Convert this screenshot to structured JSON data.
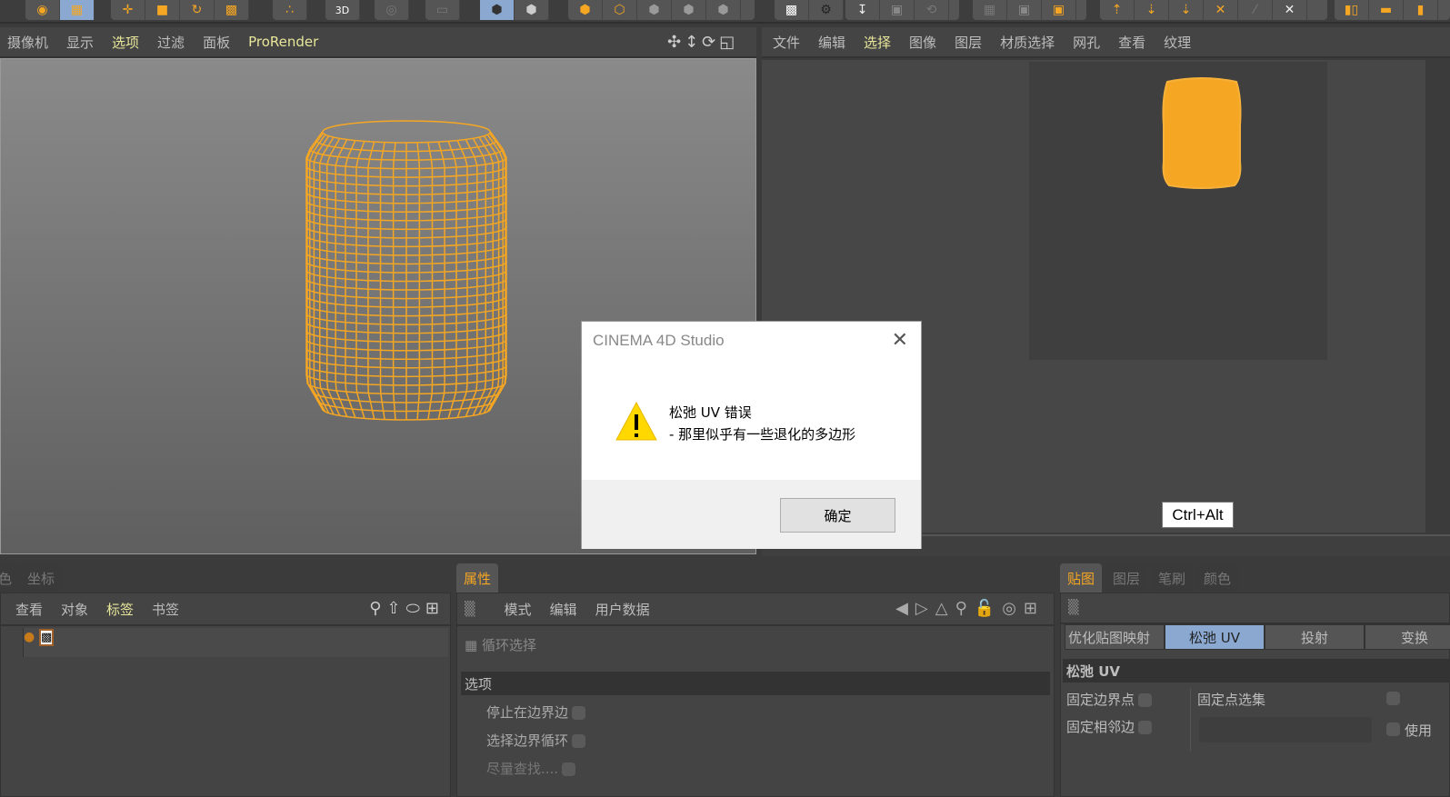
{
  "colors": {
    "accent": "#f5a623",
    "highlight": "#e7e69a",
    "selected": "#8aa8d0"
  },
  "viewport_menu": [
    "摄像机",
    "显示",
    "选项",
    "过滤",
    "面板",
    "ProRender"
  ],
  "viewport_menu_highlight": [
    2,
    5
  ],
  "uv_menu": [
    "文件",
    "编辑",
    "选择",
    "图像",
    "图层",
    "材质选择",
    "网孔",
    "查看",
    "纹理"
  ],
  "uv_menu_highlight": [
    2
  ],
  "objects_panel": {
    "tabs": [
      "色",
      "坐标"
    ],
    "menu": [
      "查看",
      "对象",
      "标签",
      "书签"
    ],
    "highlight": 2
  },
  "attributes_panel": {
    "tab": "属性",
    "menu": [
      "模式",
      "编辑",
      "用户数据"
    ],
    "tool_name": "循环选择",
    "section": "选项",
    "options": [
      {
        "label": "停止在边界边",
        "checked": false
      },
      {
        "label": "选择边界循环",
        "checked": false
      },
      {
        "label": "尽量查找....",
        "checked": false
      }
    ]
  },
  "uv_panel": {
    "tabs": [
      "贴图",
      "图层",
      "笔刷",
      "颜色"
    ],
    "subtabs": [
      "优化贴图映射",
      "松弛 UV",
      "投射",
      "变换"
    ],
    "active_subtab": 1,
    "section": "松弛 UV",
    "options_left": [
      {
        "label": "固定边界点",
        "checked": false
      },
      {
        "label": "固定相邻边",
        "checked": false
      }
    ],
    "option_right": {
      "label": "固定点选集",
      "checked": false
    },
    "option_right2": {
      "label": "使用",
      "checked": false
    }
  },
  "dialog": {
    "title": "CINEMA 4D Studio",
    "icon": "warning-icon",
    "line1": "松弛 UV 错误",
    "line2": "- 那里似乎有一些退化的多边形",
    "ok": "确定"
  },
  "tooltip": "Ctrl+Alt"
}
